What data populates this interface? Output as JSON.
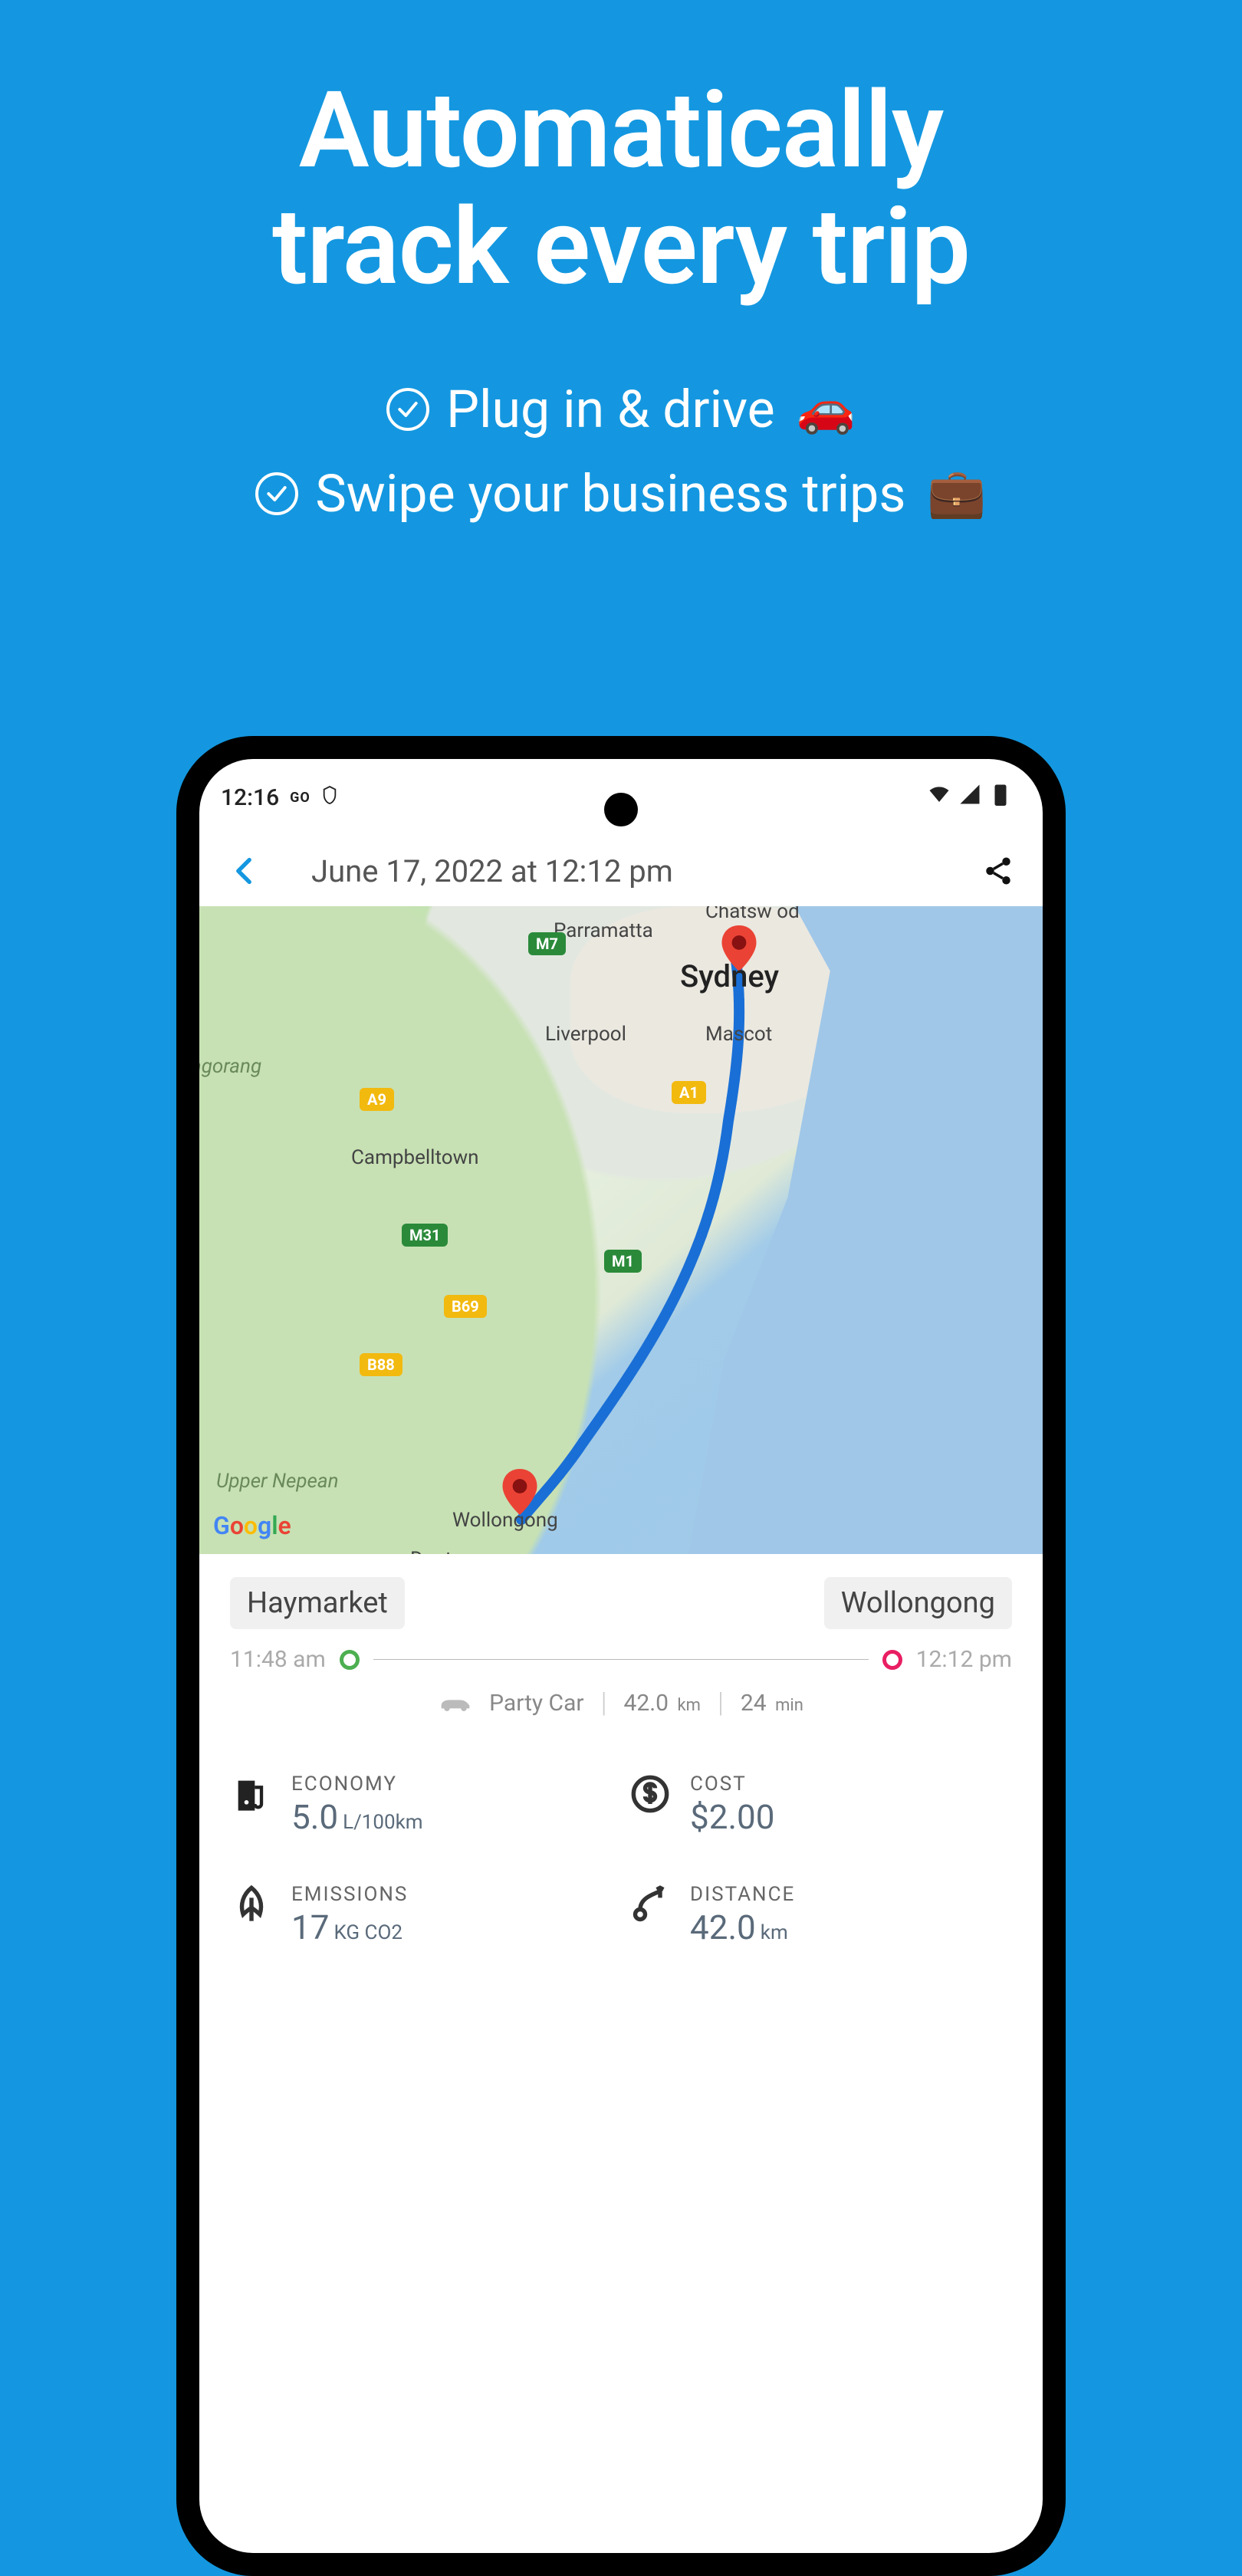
{
  "promo": {
    "headline_line1": "Automatically",
    "headline_line2": "track every trip",
    "bullets": [
      {
        "text": "Plug in & drive",
        "emoji": "🚗"
      },
      {
        "text": "Swipe your business trips",
        "emoji": "💼"
      }
    ]
  },
  "status_bar": {
    "time": "12:16",
    "badge": "GO"
  },
  "header": {
    "title": "June 17, 2022 at 12:12 pm"
  },
  "map": {
    "labels": {
      "parramatta": "Parramatta",
      "chatswood": "Chatsw od",
      "sydney": "Sydney",
      "liverpool": "Liverpool",
      "mascot": "Mascot",
      "campbelltown": "Campbelltown",
      "wollongong": "Wollongong",
      "dapto": "Dapto",
      "upper_nepean": "Upper Nepean",
      "agorang": "agorang"
    },
    "shields": {
      "m7": "M7",
      "a9": "A9",
      "a1": "A1",
      "m31": "M31",
      "m1": "M1",
      "b69": "B69",
      "b88": "B88"
    },
    "attribution": "Google"
  },
  "trip": {
    "from": "Haymarket",
    "to": "Wollongong",
    "start_time": "11:48 am",
    "end_time": "12:12 pm",
    "vehicle": "Party Car",
    "distance_inline": "42.0",
    "distance_inline_unit": "km",
    "duration": "24",
    "duration_unit": "min"
  },
  "metrics": {
    "economy": {
      "label": "ECONOMY",
      "value": "5.0",
      "unit": "L/100km"
    },
    "cost": {
      "label": "COST",
      "value": "$2.00",
      "unit": ""
    },
    "emissions": {
      "label": "EMISSIONS",
      "value": "17",
      "unit": "KG CO2"
    },
    "distance": {
      "label": "DISTANCE",
      "value": "42.0",
      "unit": "km"
    }
  }
}
